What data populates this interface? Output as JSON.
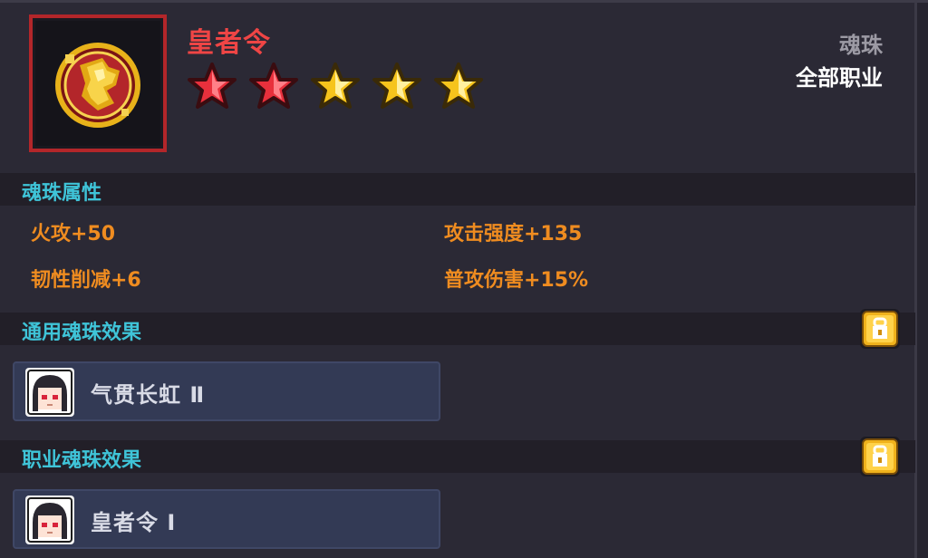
{
  "item": {
    "name": "皇者令",
    "category": "魂珠",
    "job": "全部职业",
    "star_rating": {
      "total": 5,
      "red": 2,
      "gold": 3
    },
    "colors": {
      "name": "#ef4545",
      "frame": "#b3262a",
      "star_red": "#e8303c",
      "star_gold": "#f6c41c"
    }
  },
  "attributes": {
    "title": "魂珠属性",
    "left": [
      "火攻+50",
      "韧性削减+6"
    ],
    "right": [
      "攻击强度+135",
      "普攻伤害+15%"
    ]
  },
  "common_effect": {
    "title": "通用魂珠效果",
    "badge_icon": "lock-icon",
    "card_label": "气贯长虹 Ⅱ",
    "portrait_icon": "character-portrait-icon"
  },
  "job_effect": {
    "title": "职业魂珠效果",
    "badge_icon": "lock-icon",
    "card_label": "皇者令 Ⅰ",
    "portrait_icon": "character-portrait-icon"
  }
}
